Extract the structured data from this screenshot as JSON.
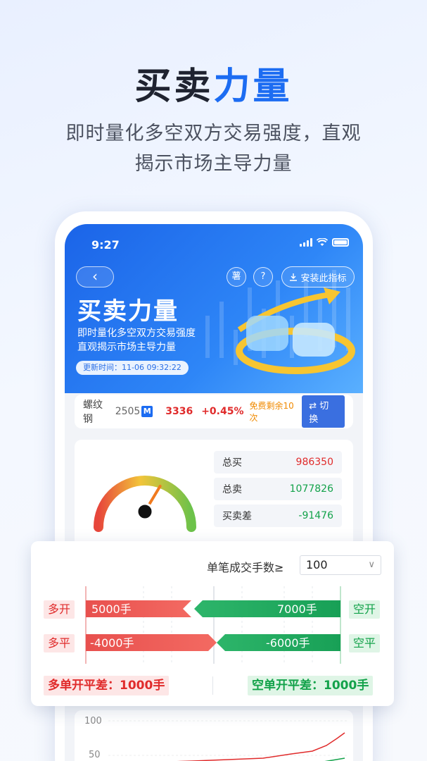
{
  "promo": {
    "title_dark": "买卖",
    "title_accent": "力量",
    "subtitle_line1": "即时量化多空双方交易强度，直观",
    "subtitle_line2": "揭示市场主导力量"
  },
  "status_bar": {
    "time": "9:27"
  },
  "header": {
    "back_icon": "chevron-left-icon",
    "notebook_label": "薯",
    "help_label": "?",
    "install_label": "安装此指标",
    "title": "买卖力量",
    "desc_line1": "即时量化多空双方交易强度",
    "desc_line2": "直观揭示市场主导力量",
    "update_time": "更新时间：11-06 09:32:22"
  },
  "quote": {
    "name": "螺纹钢",
    "code": "2505",
    "badge": "M",
    "price": "3336",
    "change": "+0.45%",
    "free_left": "免费剩余10次",
    "switch_label": "切换"
  },
  "stats": {
    "buy_label": "总买",
    "buy_value": "986350",
    "sell_label": "总卖",
    "sell_value": "1077826",
    "diff_label": "买卖差",
    "diff_value": "-91476",
    "gauge_level": 0.72
  },
  "panel": {
    "volume_label": "单笔成交手数≥",
    "volume_value": "100",
    "open_long_label": "多开",
    "open_long_value": "5000手",
    "open_short_label": "空开",
    "open_short_value": "7000手",
    "close_long_label": "多平",
    "close_long_value": "-4000手",
    "close_short_label": "空平",
    "close_short_value": "-6000手",
    "long_net_label": "多单开平差：1000手",
    "short_net_label": "空单开平差：1000手"
  },
  "chart": {
    "y_top": "100",
    "y_mid": "50"
  },
  "colors": {
    "accent": "#1c6cf2",
    "up": "#e02b2b",
    "down": "#13a24a"
  }
}
